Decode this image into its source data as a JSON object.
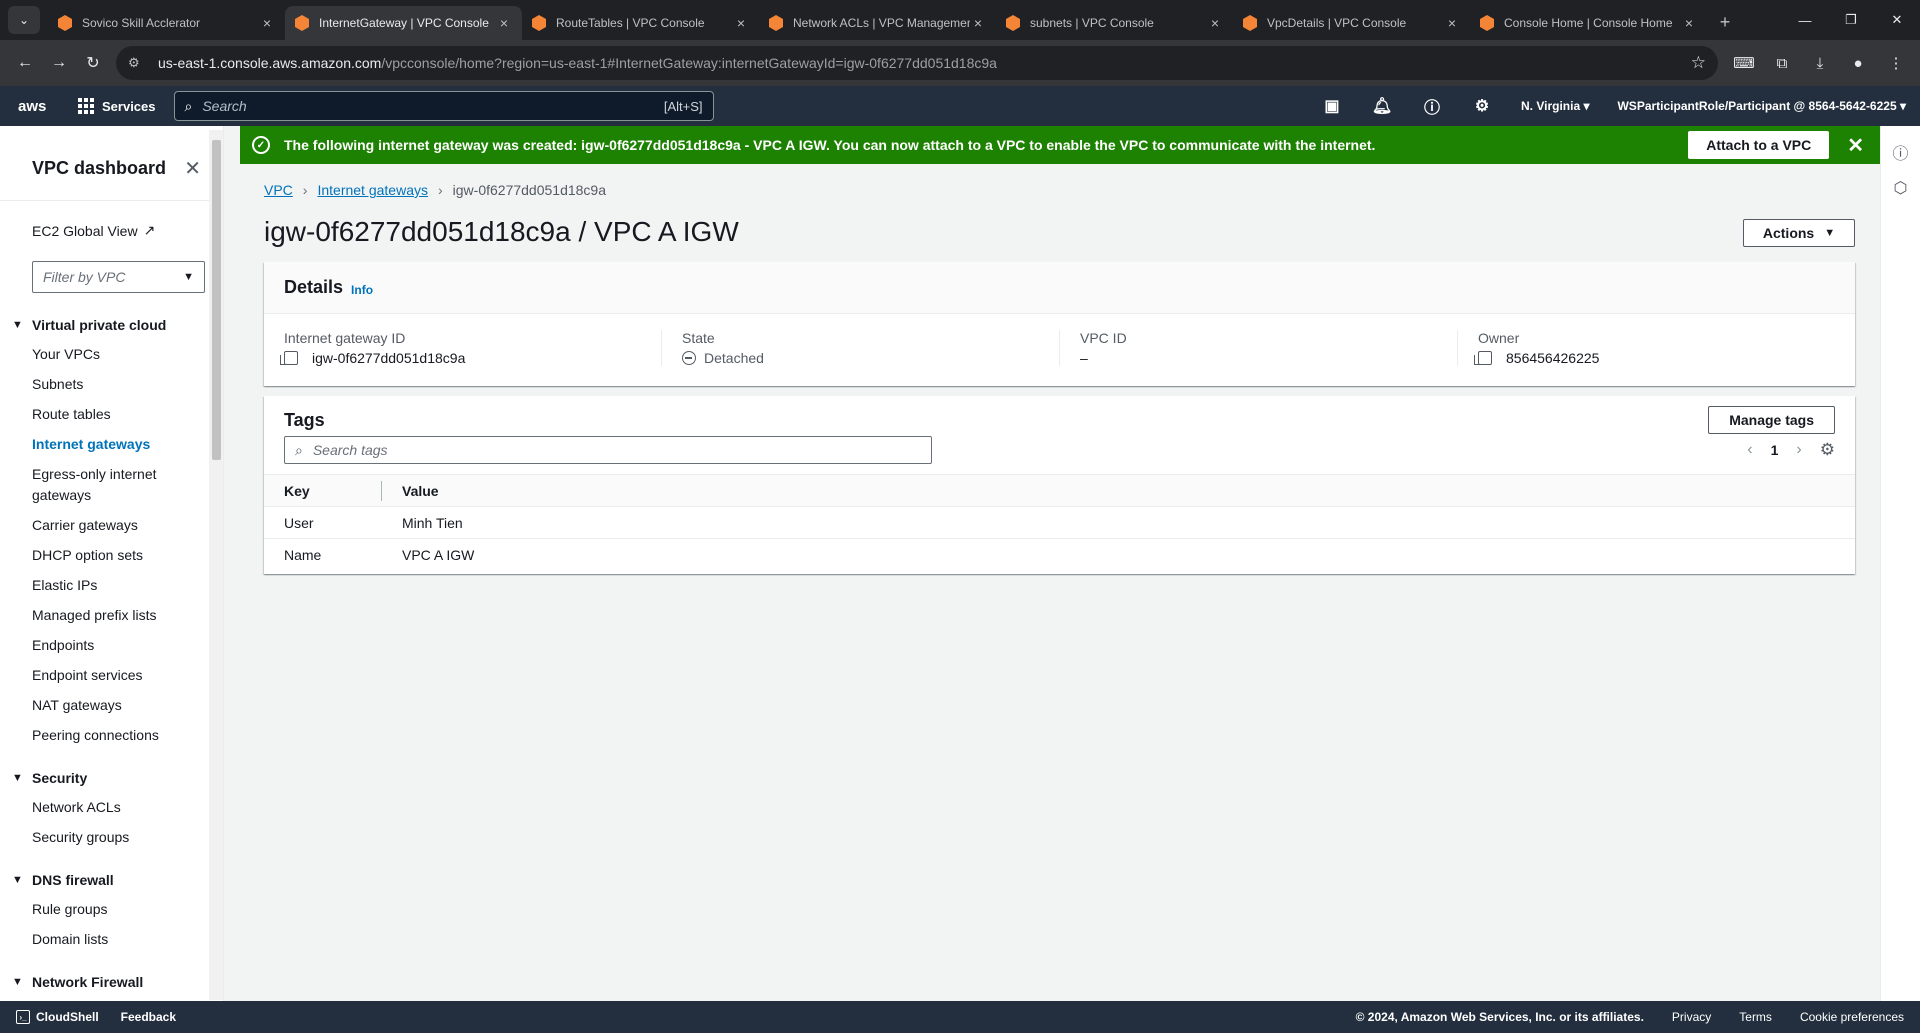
{
  "browser": {
    "tabs": [
      {
        "title": "Sovico Skill Acclerator",
        "active": false
      },
      {
        "title": "InternetGateway | VPC Console",
        "active": true
      },
      {
        "title": "RouteTables | VPC Console",
        "active": false
      },
      {
        "title": "Network ACLs | VPC Management",
        "active": false
      },
      {
        "title": "subnets | VPC Console",
        "active": false
      },
      {
        "title": "VpcDetails | VPC Console",
        "active": false
      },
      {
        "title": "Console Home | Console Home",
        "active": false
      }
    ],
    "url_host": "us-east-1.console.aws.amazon.com",
    "url_rest": "/vpcconsole/home?region=us-east-1#InternetGateway:internetGatewayId=igw-0f6277dd051d18c9a"
  },
  "awsnav": {
    "logo": "aws",
    "services": "Services",
    "search_placeholder": "Search",
    "search_hint": "[Alt+S]",
    "region": "N. Virginia",
    "account": "WSParticipantRole/Participant @ 8564-5642-6225"
  },
  "sidebar": {
    "title": "VPC dashboard",
    "global_view": "EC2 Global View",
    "filter_placeholder": "Filter by VPC",
    "sections": [
      {
        "title": "Virtual private cloud",
        "items": [
          "Your VPCs",
          "Subnets",
          "Route tables",
          "Internet gateways",
          "Egress-only internet gateways",
          "Carrier gateways",
          "DHCP option sets",
          "Elastic IPs",
          "Managed prefix lists",
          "Endpoints",
          "Endpoint services",
          "NAT gateways",
          "Peering connections"
        ]
      },
      {
        "title": "Security",
        "items": [
          "Network ACLs",
          "Security groups"
        ]
      },
      {
        "title": "DNS firewall",
        "items": [
          "Rule groups",
          "Domain lists"
        ]
      },
      {
        "title": "Network Firewall",
        "items": []
      }
    ],
    "active_item": "Internet gateways"
  },
  "flash": {
    "message": "The following internet gateway was created: igw-0f6277dd051d18c9a - VPC A IGW. You can now attach to a VPC to enable the VPC to communicate with the internet.",
    "action": "Attach to a VPC",
    "color": "#1d8102"
  },
  "breadcrumb": {
    "root": "VPC",
    "parent": "Internet gateways",
    "current": "igw-0f6277dd051d18c9a"
  },
  "page": {
    "title": "igw-0f6277dd051d18c9a / VPC A IGW",
    "actions": "Actions"
  },
  "details": {
    "heading": "Details",
    "info": "Info",
    "fields": [
      {
        "label": "Internet gateway ID",
        "value": "igw-0f6277dd051d18c9a"
      },
      {
        "label": "State",
        "value": "Detached"
      },
      {
        "label": "VPC ID",
        "value": "–"
      },
      {
        "label": "Owner",
        "value": "856456426225"
      }
    ]
  },
  "tags": {
    "heading": "Tags",
    "manage": "Manage tags",
    "search_placeholder": "Search tags",
    "page": "1",
    "columns": [
      "Key",
      "Value"
    ],
    "rows": [
      {
        "key": "User",
        "value": "Minh Tien"
      },
      {
        "key": "Name",
        "value": "VPC A IGW"
      }
    ]
  },
  "footer": {
    "cloudshell": "CloudShell",
    "feedback": "Feedback",
    "copyright": "© 2024, Amazon Web Services, Inc. or its affiliates.",
    "privacy": "Privacy",
    "terms": "Terms",
    "cookies": "Cookie preferences"
  }
}
